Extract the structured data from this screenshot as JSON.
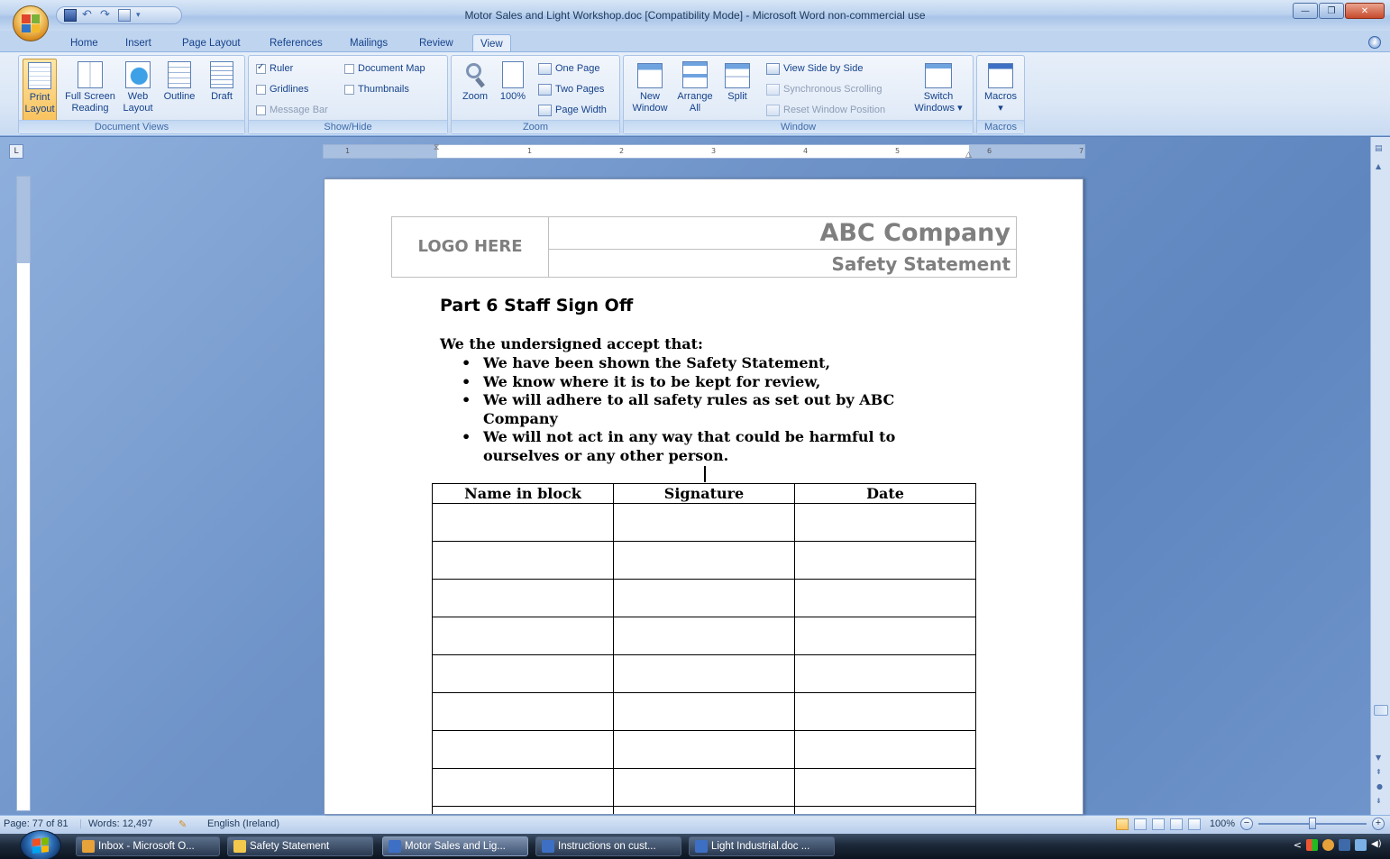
{
  "window": {
    "title": "Motor Sales and Light Workshop.doc [Compatibility Mode] - Microsoft Word non-commercial use",
    "controls": [
      "—",
      "❐",
      "✕"
    ]
  },
  "tabs": [
    "Home",
    "Insert",
    "Page Layout",
    "References",
    "Mailings",
    "Review",
    "View"
  ],
  "active_tab": "View",
  "ribbon": {
    "document_views": {
      "label": "Document Views",
      "print_layout": [
        "Print",
        "Layout"
      ],
      "full_screen_reading": [
        "Full Screen",
        "Reading"
      ],
      "web_layout": [
        "Web",
        "Layout"
      ],
      "outline": "Outline",
      "draft": "Draft"
    },
    "show_hide": {
      "label": "Show/Hide",
      "ruler": "Ruler",
      "ruler_checked": true,
      "gridlines": "Gridlines",
      "message_bar": "Message Bar",
      "document_map": "Document Map",
      "thumbnails": "Thumbnails"
    },
    "zoom": {
      "label": "Zoom",
      "zoom": "Zoom",
      "hundred": "100%",
      "one_page": "One Page",
      "two_pages": "Two Pages",
      "page_width": "Page Width"
    },
    "window": {
      "label": "Window",
      "new_window": [
        "New",
        "Window"
      ],
      "arrange_all": [
        "Arrange",
        "All"
      ],
      "split": "Split",
      "view_side_by_side": "View Side by Side",
      "sync_scrolling": "Synchronous Scrolling",
      "reset_position": "Reset Window Position",
      "switch_windows": [
        "Switch",
        "Windows ▾"
      ]
    },
    "macros": {
      "label": "Macros",
      "macros": "Macros"
    }
  },
  "ruler_numbers": [
    "1",
    "1",
    "2",
    "3",
    "4",
    "5",
    "6",
    "7"
  ],
  "document": {
    "logo_placeholder": "LOGO HERE",
    "company": "ABC Company",
    "doc_title": "Safety Statement",
    "part_title": "Part 6 Staff Sign Off",
    "intro": "We the undersigned accept that:",
    "bullets": [
      "We have been shown the Safety Statement,",
      "We know where it is to be kept for review,",
      "We will adhere to all safety rules as set out by ABC Company",
      "We will not act in any way that could be harmful to ourselves or any other person."
    ],
    "table_headers": [
      "Name in block",
      "Signature",
      "Date"
    ],
    "empty_rows": 9
  },
  "statusbar": {
    "page": "Page: 77 of 81",
    "words": "Words: 12,497",
    "language": "English (Ireland)",
    "zoom": "100%"
  },
  "taskbar": {
    "items": [
      {
        "label": "Inbox - Microsoft O...",
        "color": "#e8a23a"
      },
      {
        "label": "Safety Statement",
        "color": "#f2c94c"
      },
      {
        "label": "Motor Sales and Lig...",
        "color": "#3d6fc4",
        "active": true
      },
      {
        "label": "Instructions on cust...",
        "color": "#3d6fc4"
      },
      {
        "label": "Light Industrial.doc ...",
        "color": "#3d6fc4"
      }
    ],
    "tray_arrow": "<"
  },
  "colors": {
    "ribbon_text": "#15428b",
    "page_header_gray": "#7f7f7f",
    "taskbar": "#1c2838"
  }
}
